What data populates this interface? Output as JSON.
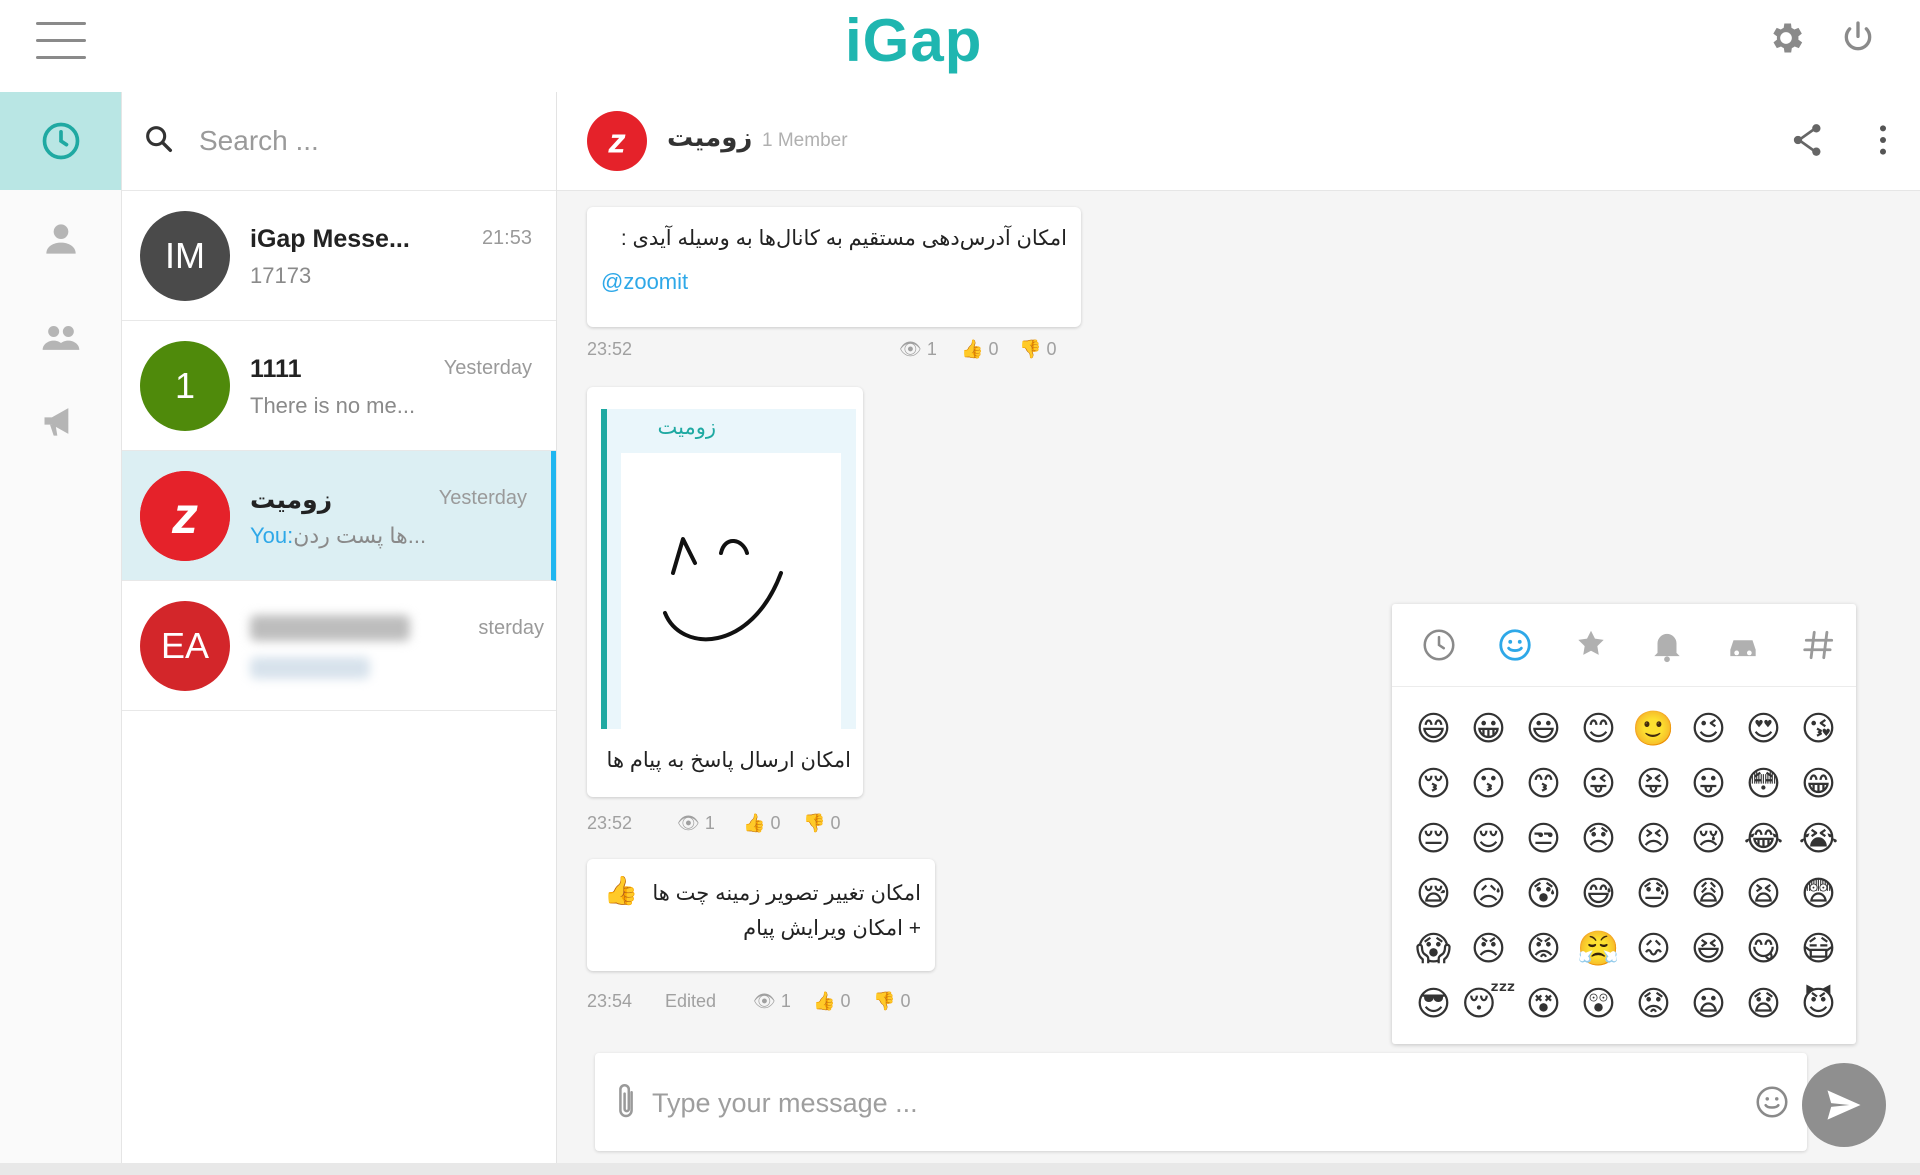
{
  "app": {
    "logo": "iGap"
  },
  "topbar": {
    "icons": [
      "hamburger-menu-icon",
      "gear-icon",
      "power-icon"
    ]
  },
  "rail": {
    "items": [
      "clock-icon",
      "contact-icon",
      "group-icon",
      "megaphone-icon"
    ],
    "active": 0
  },
  "search": {
    "placeholder": "Search ..."
  },
  "chats": [
    {
      "avatar_text": "IM",
      "avatar_color": "#4a4a4a",
      "name": "iGap Messe...",
      "time": "21:53",
      "preview": "17173"
    },
    {
      "avatar_text": "1",
      "avatar_color": "#4f8a0b",
      "name": "1111",
      "time": "Yesterday",
      "preview": "There is no me..."
    },
    {
      "avatar_icon": "zoomit-logo-icon",
      "avatar_color": "#e5222a",
      "name": "زومیت",
      "time": "Yesterday",
      "preview_you": "You:",
      "preview": "ها پست ردن..."
    },
    {
      "avatar_text": "EA",
      "avatar_color": "#d3262a",
      "time": "sterday"
    }
  ],
  "conversation": {
    "title": "زومیت",
    "members": "1 Member",
    "messages": [
      {
        "text": "امکان آدرس‌دهی مستقیم به کانال‌ها به وسیله آیدی :",
        "link": "@zoomit",
        "time": "23:52",
        "views": "1",
        "likes": "0",
        "dislikes": "0"
      },
      {
        "forward_from": "زومیت",
        "caption": "امکان ارسال پاسخ به پیام ها",
        "time": "23:52",
        "views": "1",
        "likes": "0",
        "dislikes": "0"
      },
      {
        "line1": "امکان تغییر تصویر زمینه چت ها",
        "emoji": "👍",
        "line2": "+ امکان ویرایش پیام",
        "time": "23:54",
        "edited": "Edited",
        "views": "1",
        "likes": "0",
        "dislikes": "0"
      }
    ]
  },
  "emoji_panel": {
    "tabs": [
      "recent-icon",
      "smiley-icon",
      "flower-icon",
      "bell-icon",
      "car-icon",
      "hash-icon"
    ],
    "active_tab": 1,
    "emojis": [
      "😄",
      "😀",
      "😃",
      "😊",
      "🙂",
      "😉",
      "😍",
      "😘",
      "😚",
      "😗",
      "😙",
      "😜",
      "😝",
      "😛",
      "😳",
      "😁",
      "😔",
      "😌",
      "😒",
      "😞",
      "😣",
      "😢",
      "😂",
      "😭",
      "😪",
      "😥",
      "😰",
      "😅",
      "😓",
      "😩",
      "😫",
      "😨",
      "😱",
      "😠",
      "😡",
      "😤",
      "😖",
      "😆",
      "😋",
      "😷",
      "😎",
      "😴",
      "😵",
      "😲",
      "😟",
      "😦",
      "😧",
      "😈"
    ]
  },
  "composer": {
    "placeholder": "Type your message ..."
  },
  "colors": {
    "accent": "#1fb6b0",
    "active_rail": "#b9e6e4",
    "active_chat": "#dceff3",
    "link": "#2ea8e8"
  }
}
